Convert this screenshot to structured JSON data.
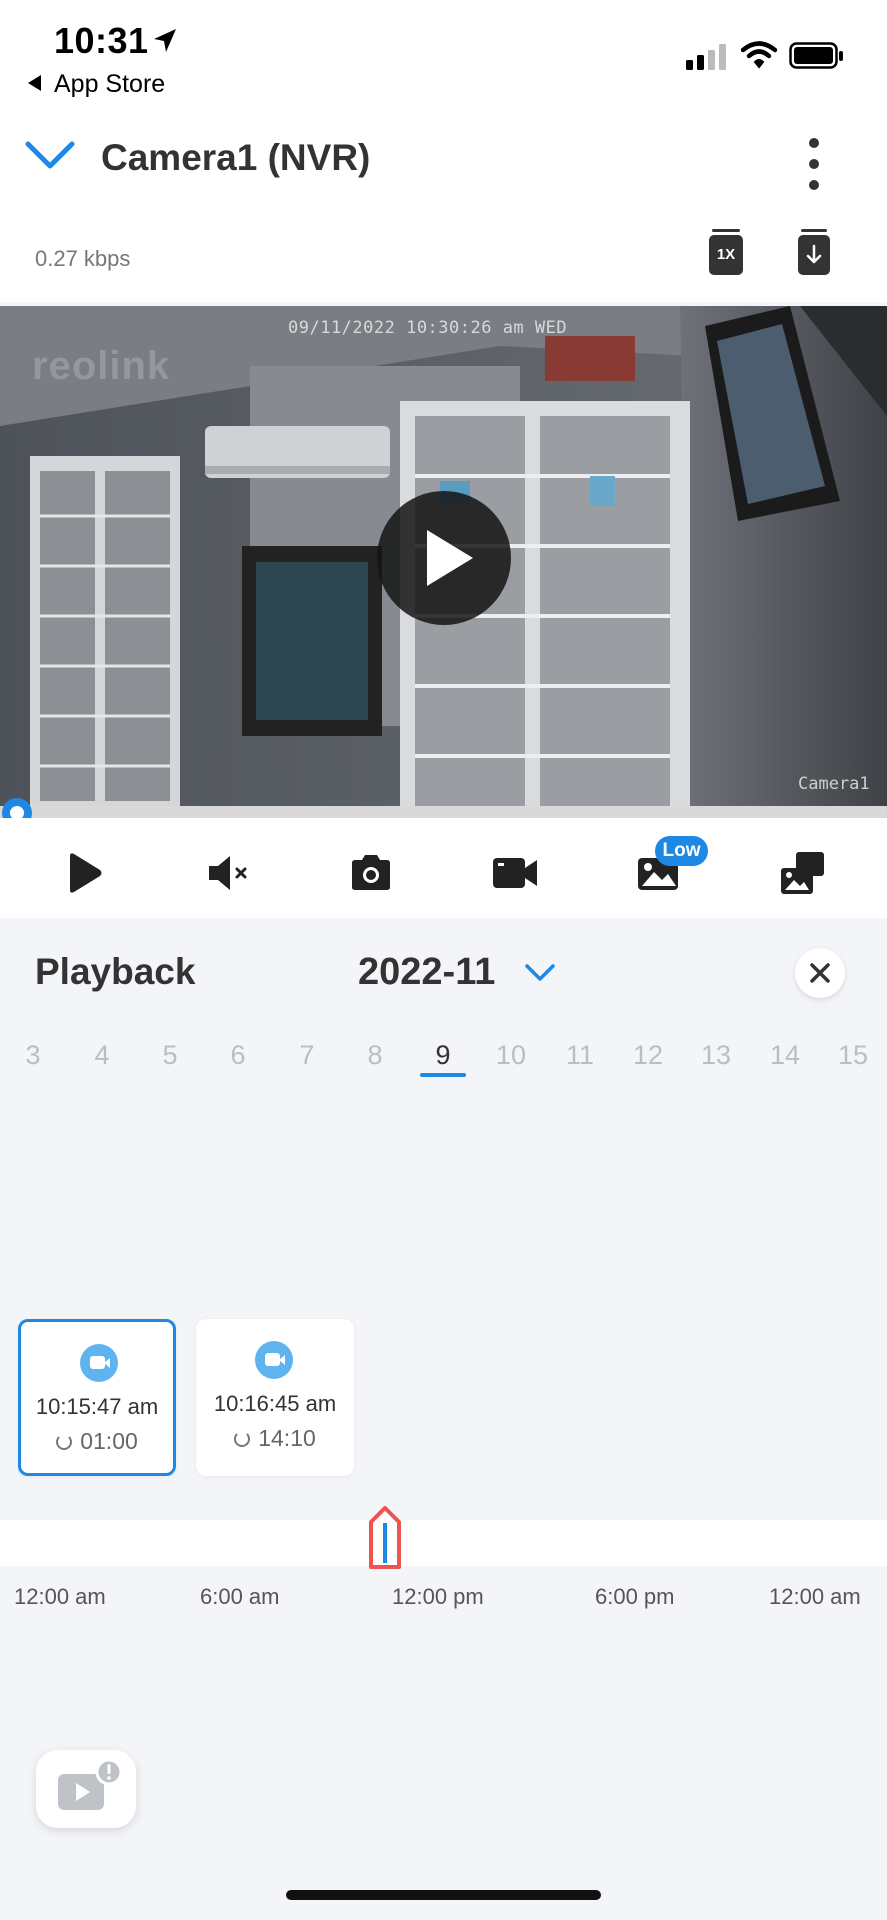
{
  "status_bar": {
    "time": "10:31",
    "back_label": "App Store",
    "icons": [
      "location-arrow-icon",
      "signal-icon",
      "wifi-icon",
      "battery-icon"
    ]
  },
  "header": {
    "title": "Camera1 (NVR)",
    "bitrate": "0.27 kbps",
    "speed_label": "1X"
  },
  "video": {
    "timestamp": "09/11/2022 10:30:26 am WED",
    "watermark": "reolink",
    "camera_label": "Camera1",
    "playback_progress": 0.0
  },
  "controls": {
    "items": [
      "play",
      "mute",
      "snapshot",
      "record",
      "quality",
      "fullscreen"
    ],
    "quality_badge": "Low"
  },
  "playback": {
    "title": "Playback",
    "month": "2022-11",
    "days": [
      "3",
      "4",
      "5",
      "6",
      "7",
      "8",
      "9",
      "10",
      "11",
      "12",
      "13",
      "14",
      "15"
    ],
    "selected_day": "9"
  },
  "recordings": [
    {
      "time": "10:15:47 am",
      "duration": "01:00",
      "selected": true
    },
    {
      "time": "10:16:45 am",
      "duration": "14:10",
      "selected": false
    }
  ],
  "timeline": {
    "labels": [
      "12:00 am",
      "6:00 am",
      "12:00 pm",
      "6:00 pm",
      "12:00 am"
    ]
  },
  "colors": {
    "accent": "#1e88e5",
    "marker": "#ef5350",
    "background": "#f3f5f8"
  }
}
